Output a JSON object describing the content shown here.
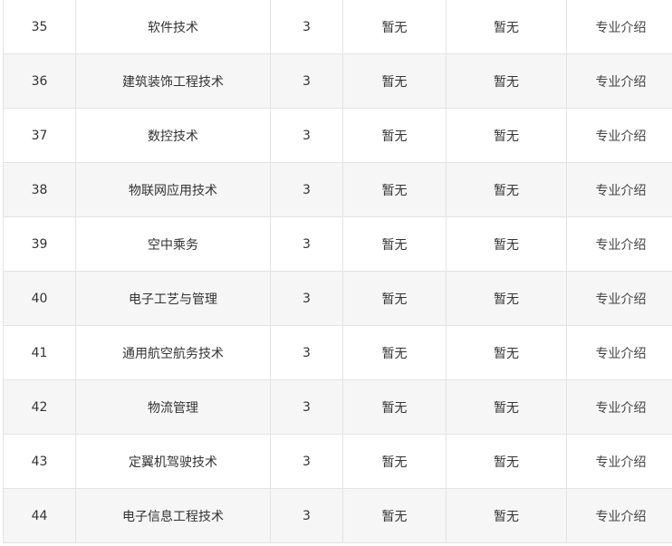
{
  "rows": [
    {
      "no": "35",
      "name": "软件技术",
      "years": "3",
      "col4": "暂无",
      "col5": "暂无",
      "intro": "专业介绍"
    },
    {
      "no": "36",
      "name": "建筑装饰工程技术",
      "years": "3",
      "col4": "暂无",
      "col5": "暂无",
      "intro": "专业介绍"
    },
    {
      "no": "37",
      "name": "数控技术",
      "years": "3",
      "col4": "暂无",
      "col5": "暂无",
      "intro": "专业介绍"
    },
    {
      "no": "38",
      "name": "物联网应用技术",
      "years": "3",
      "col4": "暂无",
      "col5": "暂无",
      "intro": "专业介绍"
    },
    {
      "no": "39",
      "name": "空中乘务",
      "years": "3",
      "col4": "暂无",
      "col5": "暂无",
      "intro": "专业介绍"
    },
    {
      "no": "40",
      "name": "电子工艺与管理",
      "years": "3",
      "col4": "暂无",
      "col5": "暂无",
      "intro": "专业介绍"
    },
    {
      "no": "41",
      "name": "通用航空航务技术",
      "years": "3",
      "col4": "暂无",
      "col5": "暂无",
      "intro": "专业介绍"
    },
    {
      "no": "42",
      "name": "物流管理",
      "years": "3",
      "col4": "暂无",
      "col5": "暂无",
      "intro": "专业介绍"
    },
    {
      "no": "43",
      "name": "定翼机驾驶技术",
      "years": "3",
      "col4": "暂无",
      "col5": "暂无",
      "intro": "专业介绍"
    },
    {
      "no": "44",
      "name": "电子信息工程技术",
      "years": "3",
      "col4": "暂无",
      "col5": "暂无",
      "intro": "专业介绍"
    }
  ]
}
